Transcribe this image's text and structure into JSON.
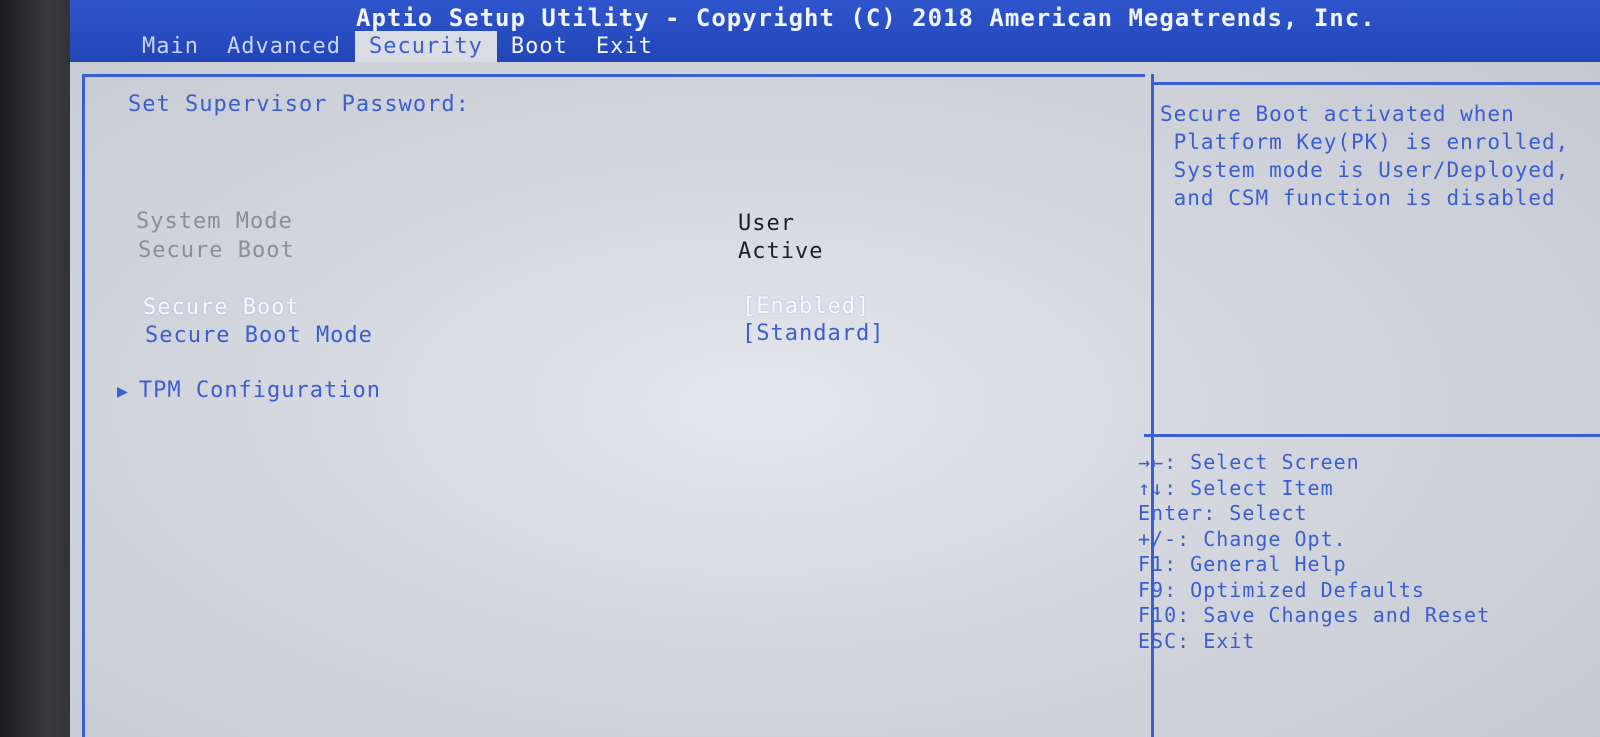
{
  "header": {
    "title": "Aptio Setup Utility - Copyright (C) 2018 American Megatrends, Inc.",
    "tabs": [
      "Main",
      "Advanced",
      "Security",
      "Boot",
      "Exit"
    ],
    "active_tab": "Security"
  },
  "main": {
    "supervisor_password": "Set Supervisor Password:",
    "system_mode": {
      "label": "System Mode",
      "value": "User"
    },
    "secure_boot_status": {
      "label": "Secure Boot",
      "value": "Active"
    },
    "secure_boot": {
      "label": "Secure Boot",
      "value": "[Enabled]"
    },
    "secure_boot_mode": {
      "label": "Secure Boot Mode",
      "value": "[Standard]"
    },
    "tpm_config": {
      "label": "TPM Configuration",
      "icon": "submenu-arrow-icon"
    }
  },
  "help": {
    "lines": [
      "Secure Boot activated when",
      " Platform Key(PK) is enrolled,",
      " System mode is User/Deployed,",
      " and CSM function is disabled"
    ]
  },
  "keys": [
    {
      "key": "→←:",
      "desc": "Select Screen"
    },
    {
      "key": "↑↓:",
      "desc": "Select Item"
    },
    {
      "key": "Enter:",
      "desc": "Select"
    },
    {
      "key": "+/-:",
      "desc": "Change Opt."
    },
    {
      "key": "F1:",
      "desc": "General Help"
    },
    {
      "key": "F9:",
      "desc": "Optimized Defaults"
    },
    {
      "key": "F10:",
      "desc": "Save Changes and Reset"
    },
    {
      "key": "ESC:",
      "desc": "Exit"
    }
  ],
  "colors": {
    "header_bg": "#2246b8",
    "accent_blue": "#3a5fd0",
    "screen_bg": "#d3d6dd",
    "highlight_text": "#f7f8fc",
    "grayed_text": "#8b8e96"
  }
}
